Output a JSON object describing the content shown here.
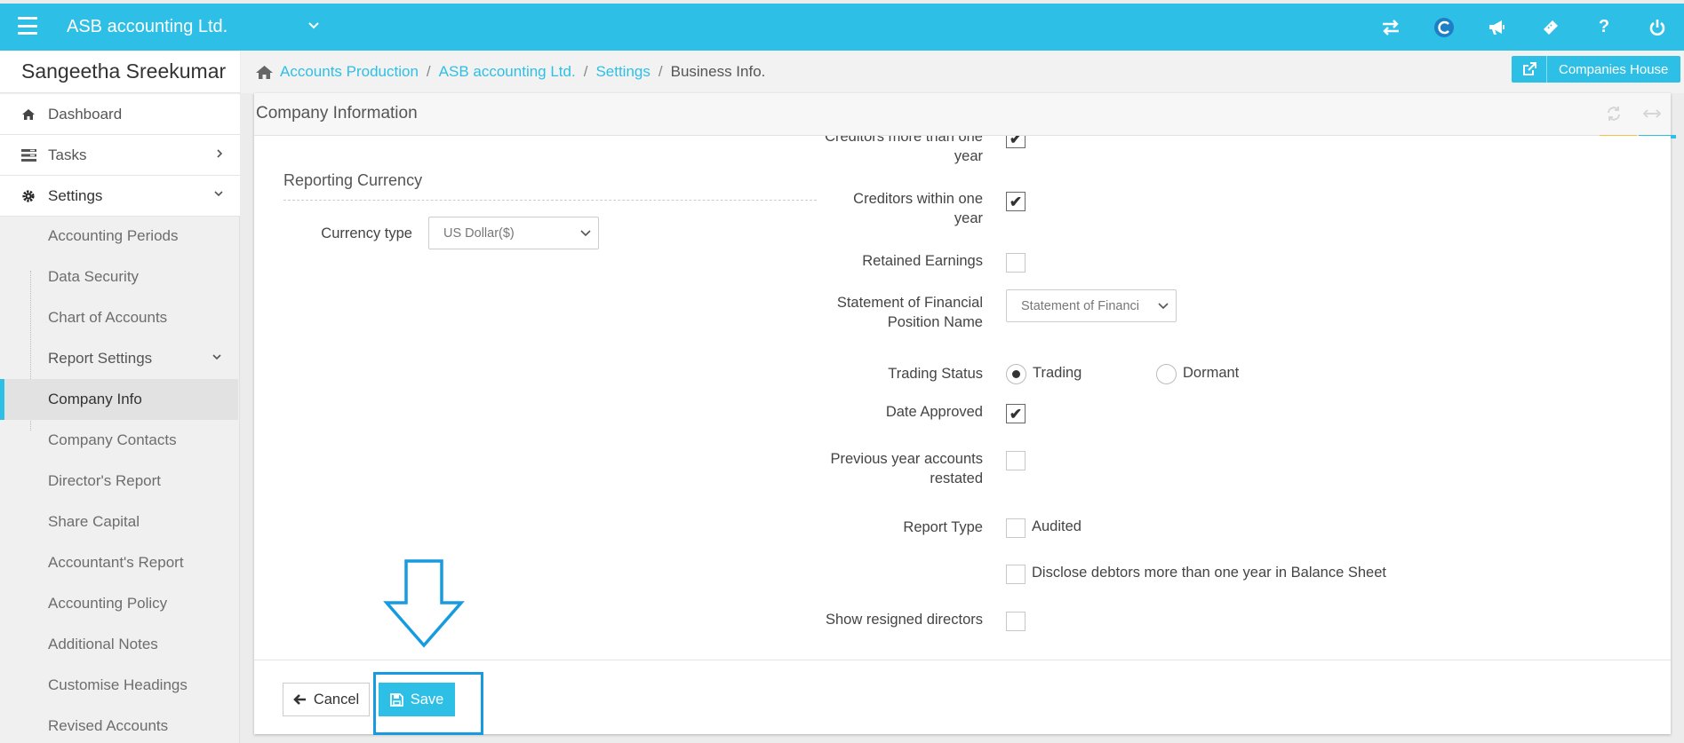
{
  "app": {
    "title": "ASB accounting Ltd."
  },
  "topbar": {
    "icons": [
      "menu-icon",
      "chevron-down-icon",
      "switch-icon",
      "c-logo-icon",
      "megaphone-icon",
      "ticket-icon",
      "help-icon",
      "power-icon"
    ],
    "help_glyph": "?"
  },
  "sidebar": {
    "user_name": "Sangeetha Sreekumar",
    "top_items": [
      {
        "label": "Dashboard",
        "icon": "home-icon"
      },
      {
        "label": "Tasks",
        "icon": "tasks-icon"
      },
      {
        "label": "Settings",
        "icon": "gear-icon"
      }
    ],
    "sub_items": [
      {
        "label": "Accounting Periods"
      },
      {
        "label": "Data Security"
      },
      {
        "label": "Chart of Accounts"
      },
      {
        "label": "Report Settings"
      },
      {
        "label": "Company Info"
      },
      {
        "label": "Company Contacts"
      },
      {
        "label": "Director's Report"
      },
      {
        "label": "Share Capital"
      },
      {
        "label": "Accountant's Report"
      },
      {
        "label": "Accounting Policy"
      },
      {
        "label": "Additional Notes"
      },
      {
        "label": "Customise Headings"
      },
      {
        "label": "Revised Accounts"
      }
    ],
    "active_item": "Company Info"
  },
  "breadcrumb": {
    "items": [
      "Accounts Production",
      "ASB accounting Ltd.",
      "Settings"
    ],
    "current": "Business Info."
  },
  "companies_house_button": {
    "label": "Companies House"
  },
  "card": {
    "title": "Company Information"
  },
  "reporting_currency": {
    "section_title": "Reporting Currency",
    "currency_type_label": "Currency type",
    "currency_type_value": "US Dollar($)"
  },
  "form": {
    "creditors_more_label": "Creditors more than one year",
    "creditors_more_checked": true,
    "creditors_within_label": "Creditors within one year",
    "creditors_within_checked": true,
    "retained_earnings_label": "Retained Earnings",
    "retained_earnings_checked": false,
    "sofp_label": "Statement of Financial Position Name",
    "sofp_value": "Statement of Financi",
    "trading_status_label": "Trading Status",
    "trading_status_options": [
      "Trading",
      "Dormant"
    ],
    "trading_status_selected": "Trading",
    "date_approved_label": "Date Approved",
    "date_approved_checked": true,
    "prev_year_label": "Previous year accounts restated",
    "prev_year_checked": false,
    "report_type_label": "Report Type",
    "audited_label": "Audited",
    "audited_checked": false,
    "disclose_label": "Disclose debtors more than one year in Balance Sheet",
    "disclose_checked": false,
    "show_resigned_label": "Show resigned directors",
    "show_resigned_checked": false,
    "check_glyph": "✔"
  },
  "footer": {
    "cancel_label": "Cancel",
    "save_label": "Save"
  },
  "colors": {
    "brand": "#2ebfe6",
    "annotation": "#169be0",
    "tab_yellow": "#f5c342"
  }
}
